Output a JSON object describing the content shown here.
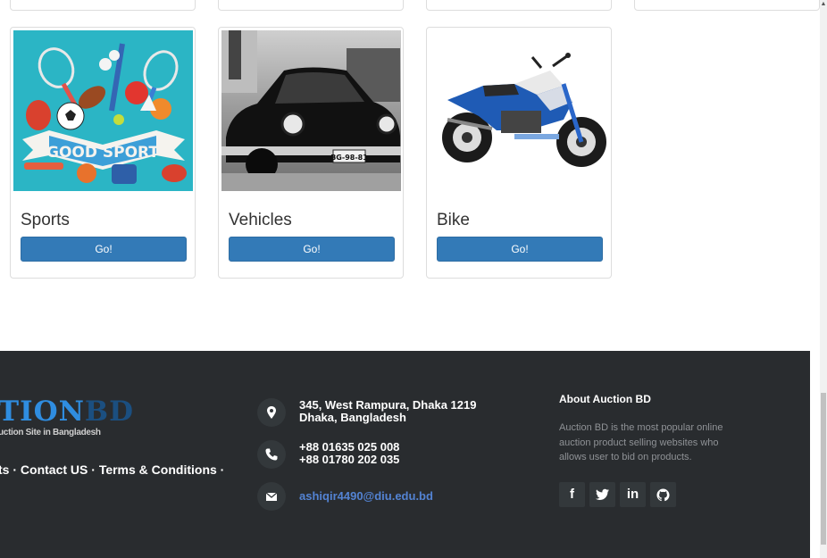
{
  "categories": [
    {
      "name": "Sports",
      "button": "Go!",
      "image": "good-sport-illustration",
      "banner_text": "GOOD SPORT"
    },
    {
      "name": "Vehicles",
      "button": "Go!",
      "image": "vintage-black-car-photo",
      "plate_text": "BG-98-81"
    },
    {
      "name": "Bike",
      "button": "Go!",
      "image": "blue-motorcycle-photo"
    }
  ],
  "footer": {
    "logo": {
      "part1": "TION",
      "part2": "BD",
      "tagline": "uction Site in Bangladesh"
    },
    "links": {
      "item1": "ts",
      "sep": " · ",
      "item2": "Contact US",
      "item3": "Terms & Conditions",
      "trail": " ·"
    },
    "contact": {
      "address_line1": "345, West Rampura, Dhaka 1219",
      "address_line2": "Dhaka, Bangladesh",
      "phone1": "+88 01635 025 008",
      "phone2": "+88 01780 202 035",
      "email": "ashiqir4490@diu.edu.bd"
    },
    "about": {
      "heading": "About Auction BD",
      "text": "Auction BD is the most popular online auction product selling websites who allows user to bid on products."
    },
    "social": [
      {
        "icon": "facebook-icon",
        "glyph": "f"
      },
      {
        "icon": "twitter-icon",
        "glyph": ""
      },
      {
        "icon": "linkedin-icon",
        "glyph": "in"
      },
      {
        "icon": "github-icon",
        "glyph": ""
      }
    ]
  },
  "colors": {
    "primary": "#337ab7",
    "footer_bg": "#292c2f",
    "email_link": "#5383d3",
    "icon_bg": "#33383b"
  }
}
